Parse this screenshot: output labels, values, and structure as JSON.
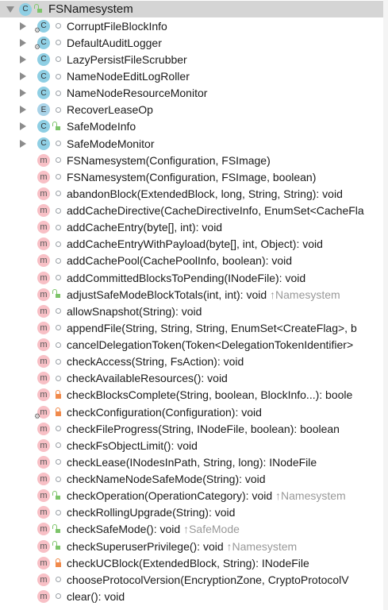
{
  "root": {
    "label": "FSNamesystem",
    "kind": "class",
    "visibility": "public"
  },
  "children": [
    {
      "label": "CorruptFileBlockInfo",
      "kind": "class",
      "visibility": "package",
      "expandable": true,
      "static": true
    },
    {
      "label": "DefaultAuditLogger",
      "kind": "class",
      "visibility": "package",
      "expandable": true,
      "static": true
    },
    {
      "label": "LazyPersistFileScrubber",
      "kind": "class",
      "visibility": "package",
      "expandable": true
    },
    {
      "label": "NameNodeEditLogRoller",
      "kind": "class",
      "visibility": "package",
      "expandable": true
    },
    {
      "label": "NameNodeResourceMonitor",
      "kind": "class",
      "visibility": "package",
      "expandable": true
    },
    {
      "label": "RecoverLeaseOp",
      "kind": "enum",
      "visibility": "package",
      "expandable": true
    },
    {
      "label": "SafeModeInfo",
      "kind": "class",
      "visibility": "public",
      "expandable": true
    },
    {
      "label": "SafeModeMonitor",
      "kind": "class",
      "visibility": "package",
      "expandable": true
    },
    {
      "label": "FSNamesystem(Configuration, FSImage)",
      "kind": "method",
      "visibility": "package"
    },
    {
      "label": "FSNamesystem(Configuration, FSImage, boolean)",
      "kind": "method",
      "visibility": "package"
    },
    {
      "label": "abandonBlock(ExtendedBlock, long, String, String): void",
      "kind": "method",
      "visibility": "package"
    },
    {
      "label": "addCacheDirective(CacheDirectiveInfo, EnumSet<CacheFla",
      "kind": "method",
      "visibility": "package"
    },
    {
      "label": "addCacheEntry(byte[], int): void",
      "kind": "method",
      "visibility": "package"
    },
    {
      "label": "addCacheEntryWithPayload(byte[], int, Object): void",
      "kind": "method",
      "visibility": "package"
    },
    {
      "label": "addCachePool(CachePoolInfo, boolean): void",
      "kind": "method",
      "visibility": "package"
    },
    {
      "label": "addCommittedBlocksToPending(INodeFile): void",
      "kind": "method",
      "visibility": "package"
    },
    {
      "label": "adjustSafeModeBlockTotals(int, int): void",
      "kind": "method",
      "visibility": "public",
      "inherited": "↑Namesystem"
    },
    {
      "label": "allowSnapshot(String): void",
      "kind": "method",
      "visibility": "package"
    },
    {
      "label": "appendFile(String, String, String, EnumSet<CreateFlag>, b",
      "kind": "method",
      "visibility": "package"
    },
    {
      "label": "cancelDelegationToken(Token<DelegationTokenIdentifier>",
      "kind": "method",
      "visibility": "package"
    },
    {
      "label": "checkAccess(String, FsAction): void",
      "kind": "method",
      "visibility": "package"
    },
    {
      "label": "checkAvailableResources(): void",
      "kind": "method",
      "visibility": "package"
    },
    {
      "label": "checkBlocksComplete(String, boolean, BlockInfo...): boole",
      "kind": "method",
      "visibility": "private"
    },
    {
      "label": "checkConfiguration(Configuration): void",
      "kind": "method",
      "visibility": "private",
      "static": true
    },
    {
      "label": "checkFileProgress(String, INodeFile, boolean): boolean",
      "kind": "method",
      "visibility": "package"
    },
    {
      "label": "checkFsObjectLimit(): void",
      "kind": "method",
      "visibility": "package"
    },
    {
      "label": "checkLease(INodesInPath, String, long): INodeFile",
      "kind": "method",
      "visibility": "package"
    },
    {
      "label": "checkNameNodeSafeMode(String): void",
      "kind": "method",
      "visibility": "package"
    },
    {
      "label": "checkOperation(OperationCategory): void",
      "kind": "method",
      "visibility": "public",
      "inherited": "↑Namesystem"
    },
    {
      "label": "checkRollingUpgrade(String): void",
      "kind": "method",
      "visibility": "package"
    },
    {
      "label": "checkSafeMode(): void",
      "kind": "method",
      "visibility": "public",
      "inherited": "↑SafeMode"
    },
    {
      "label": "checkSuperuserPrivilege(): void",
      "kind": "method",
      "visibility": "public",
      "inherited": "↑Namesystem"
    },
    {
      "label": "checkUCBlock(ExtendedBlock, String): INodeFile",
      "kind": "method",
      "visibility": "private"
    },
    {
      "label": "chooseProtocolVersion(EncryptionZone, CryptoProtocolV",
      "kind": "method",
      "visibility": "package"
    },
    {
      "label": "clear(): void",
      "kind": "method",
      "visibility": "package"
    }
  ]
}
